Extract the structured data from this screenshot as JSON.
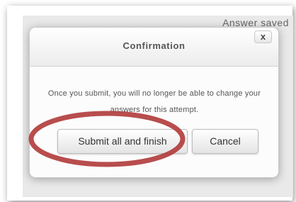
{
  "page": {
    "status_text": "Answer saved"
  },
  "dialog": {
    "title": "Confirmation",
    "close_label": "x",
    "message": "Once you submit, you will no longer be able to change your answers for this attempt.",
    "submit_label": "Submit all and finish",
    "cancel_label": "Cancel"
  },
  "colors": {
    "annotation_circle": "#b03a3a",
    "dialog_background": "#fcfcfc",
    "page_background": "#e9e9e9"
  }
}
